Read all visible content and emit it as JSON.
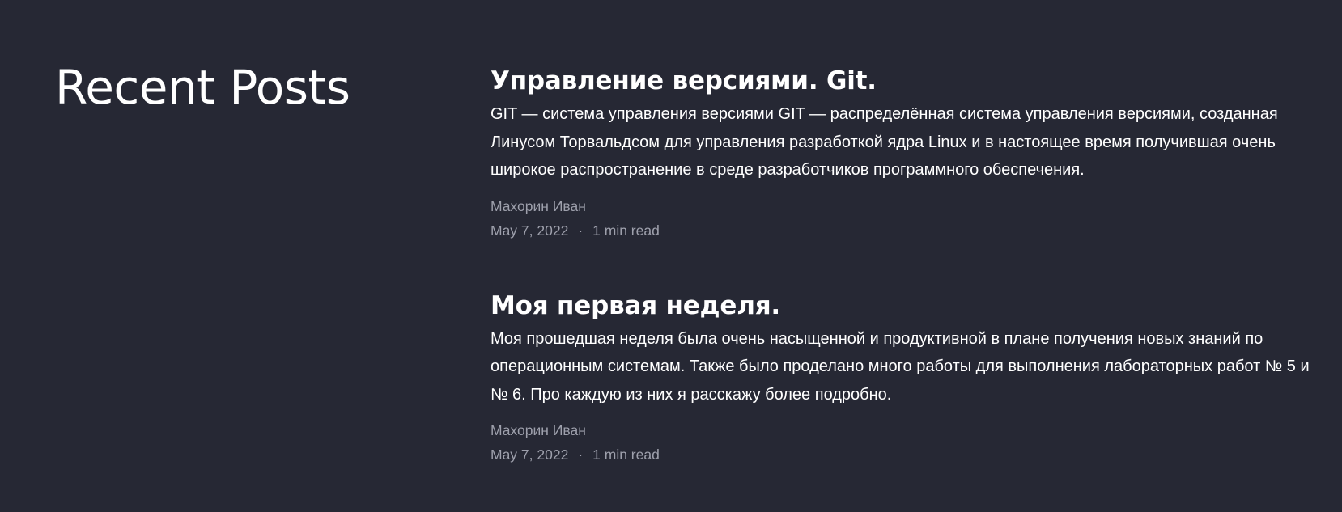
{
  "section": {
    "title": "Recent Posts"
  },
  "posts": [
    {
      "title": "Управление версиями. Git.",
      "excerpt": "GIT — система управления версиями GIT — распределённая система управления версиями, созданная Линусом Торвальдсом для управления разработкой ядра Linux и в настоящее время получившая очень широкое распространение в среде разработчиков программного обеспечения.",
      "author": "Махорин Иван",
      "date": "May 7, 2022",
      "separator": "·",
      "read_time": "1 min read"
    },
    {
      "title": "Моя первая неделя.",
      "excerpt": "Моя прошедшая неделя была очень насыщенной и продуктивной в плане получения новых знаний по операционным системам. Также было проделано много работы для выполнения лабораторных работ № 5 и № 6. Про каждую из них я расскажу более подробно.",
      "author": "Махорин Иван",
      "date": "May 7, 2022",
      "separator": "·",
      "read_time": "1 min read"
    }
  ],
  "colors": {
    "background": "#262834",
    "text": "#ffffff",
    "meta": "#9ea0ac"
  }
}
